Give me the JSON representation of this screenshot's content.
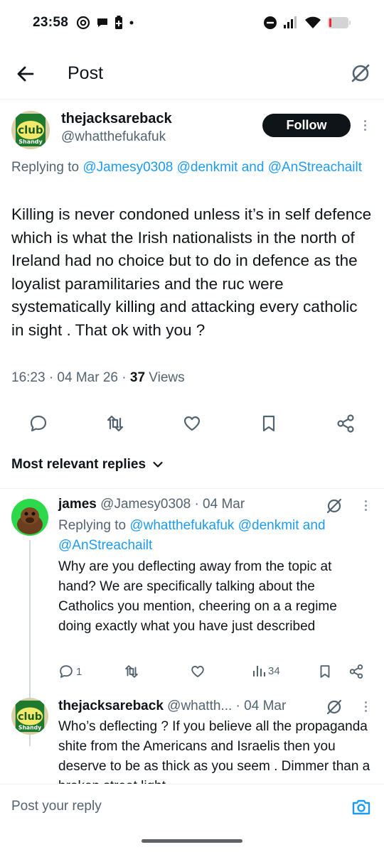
{
  "status_bar": {
    "time": "23:58",
    "battery_color": "#f4212e"
  },
  "header": {
    "title": "Post"
  },
  "main_tweet": {
    "display_name": "thejacksareback",
    "handle": "@whatthefukafuk",
    "follow_label": "Follow",
    "replying_prefix": "Replying to",
    "replying_to": "@Jamesy0308 @denkmit and @AnStreachailt",
    "text": "Killing is never condoned unless it’s in self defence which is what the Irish nationalists in the north of Ireland had no choice but to do in defence as the loyalist paramilitaries and the ruc were systematically killing and attacking every catholic in sight . That ok with you ?",
    "timestamp": "16:23 · 04 Mar 26 · ",
    "views_count": "37",
    "views_label": " Views"
  },
  "sort": {
    "label": "Most relevant replies"
  },
  "replies": [
    {
      "display_name": "james",
      "handle_date": " @Jamesy0308 · 04 Mar",
      "replying_prefix": "Replying to",
      "replying_to": "@whatthefukafuk @denkmit and @AnStreachailt",
      "text": "Why are you deflecting away from the topic at hand? We are specifically talking about the Catholics you mention, cheering on a a regime doing exactly what you have just described",
      "reply_count": "1",
      "views": "34"
    },
    {
      "display_name": "thejacksareback",
      "handle_date": " @whatth... · 04 Mar",
      "text": "Who’s deflecting ? If you believe all the propaganda shite from the Americans and Israelis then you deserve to be as thick as you seem . Dimmer than a broken street light"
    }
  ],
  "composer": {
    "placeholder": "Post your reply"
  },
  "colors": {
    "accent": "#1d9bf0",
    "text": "#0f1419",
    "secondary": "#536471"
  }
}
